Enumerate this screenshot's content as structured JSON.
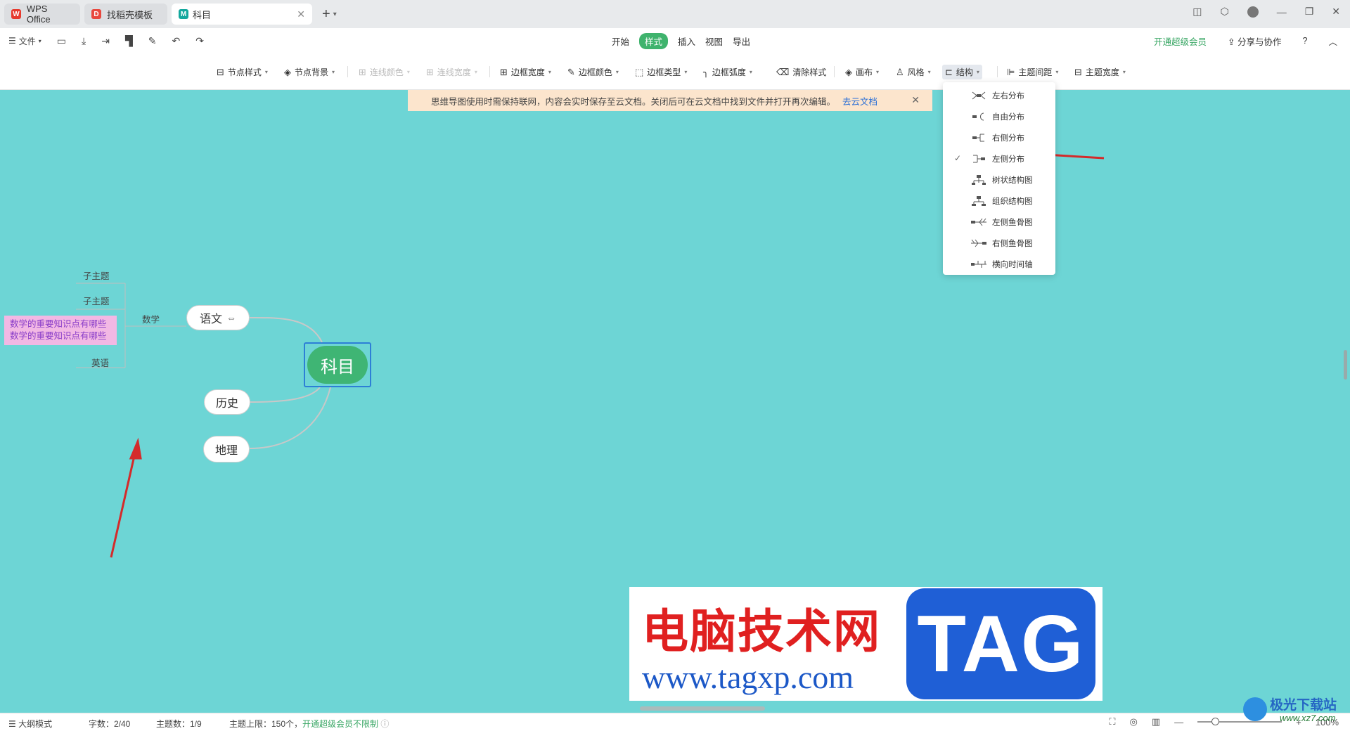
{
  "tabs": [
    {
      "label": "WPS Office",
      "icon": "wps-logo-icon"
    },
    {
      "label": "找稻壳模板",
      "icon": "docer-icon"
    },
    {
      "label": "科目",
      "icon": "mindmap-file-icon"
    }
  ],
  "menu": {
    "file_label": "文件",
    "center_items": [
      "开始",
      "样式",
      "插入",
      "视图",
      "导出"
    ],
    "active_item": "样式",
    "vip_label": "开通超级会员",
    "share_label": "分享与协作"
  },
  "toolbar": {
    "node_style": "节点样式",
    "node_bg": "节点背景",
    "line_color": "连线颜色",
    "line_width": "连线宽度",
    "border_width": "边框宽度",
    "border_color": "边框颜色",
    "border_type": "边框类型",
    "border_radius": "边框弧度",
    "clear_style": "清除样式",
    "canvas": "画布",
    "theme_style": "风格",
    "structure": "结构",
    "topic_spacing": "主题间距",
    "topic_width": "主题宽度"
  },
  "notice": {
    "text": "思维导图使用时需保持联网，内容会实时保存至云文档。关闭后可在云文档中找到文件并打开再次编辑。",
    "link": "去云文档"
  },
  "structure_menu": {
    "items": [
      "左右分布",
      "自由分布",
      "右侧分布",
      "左侧分布",
      "树状结构图",
      "组织结构图",
      "左侧鱼骨图",
      "右侧鱼骨图",
      "横向时间轴"
    ],
    "checked": "左侧分布"
  },
  "mindmap": {
    "root": "科目",
    "branches": [
      "语文",
      "历史",
      "地理"
    ],
    "sub_label": "数学",
    "leaves": [
      "子主题",
      "子主题",
      "英语"
    ],
    "highlight_lines": [
      "数学的重要知识点有哪些",
      "数学的重要知识点有哪些"
    ]
  },
  "watermark": {
    "title": "电脑技术网",
    "url": "www.tagxp.com",
    "tag": "TAG"
  },
  "corner_logo": {
    "text": "极光下载站",
    "url": "www.xz7.com"
  },
  "status": {
    "outline_mode": "大纲模式",
    "word_count": "字数：2/40",
    "topic_count": "主题数：1/9",
    "topic_limit": "主题上限：150个，",
    "vip_unlimited": "开通超级会员不限制",
    "zoom": "100%"
  },
  "colors": {
    "canvas": "#6dd5d5",
    "accent_green": "#3fb574",
    "selection_blue": "#2d7fd6",
    "annotation_arrow": "#d42a2a"
  }
}
